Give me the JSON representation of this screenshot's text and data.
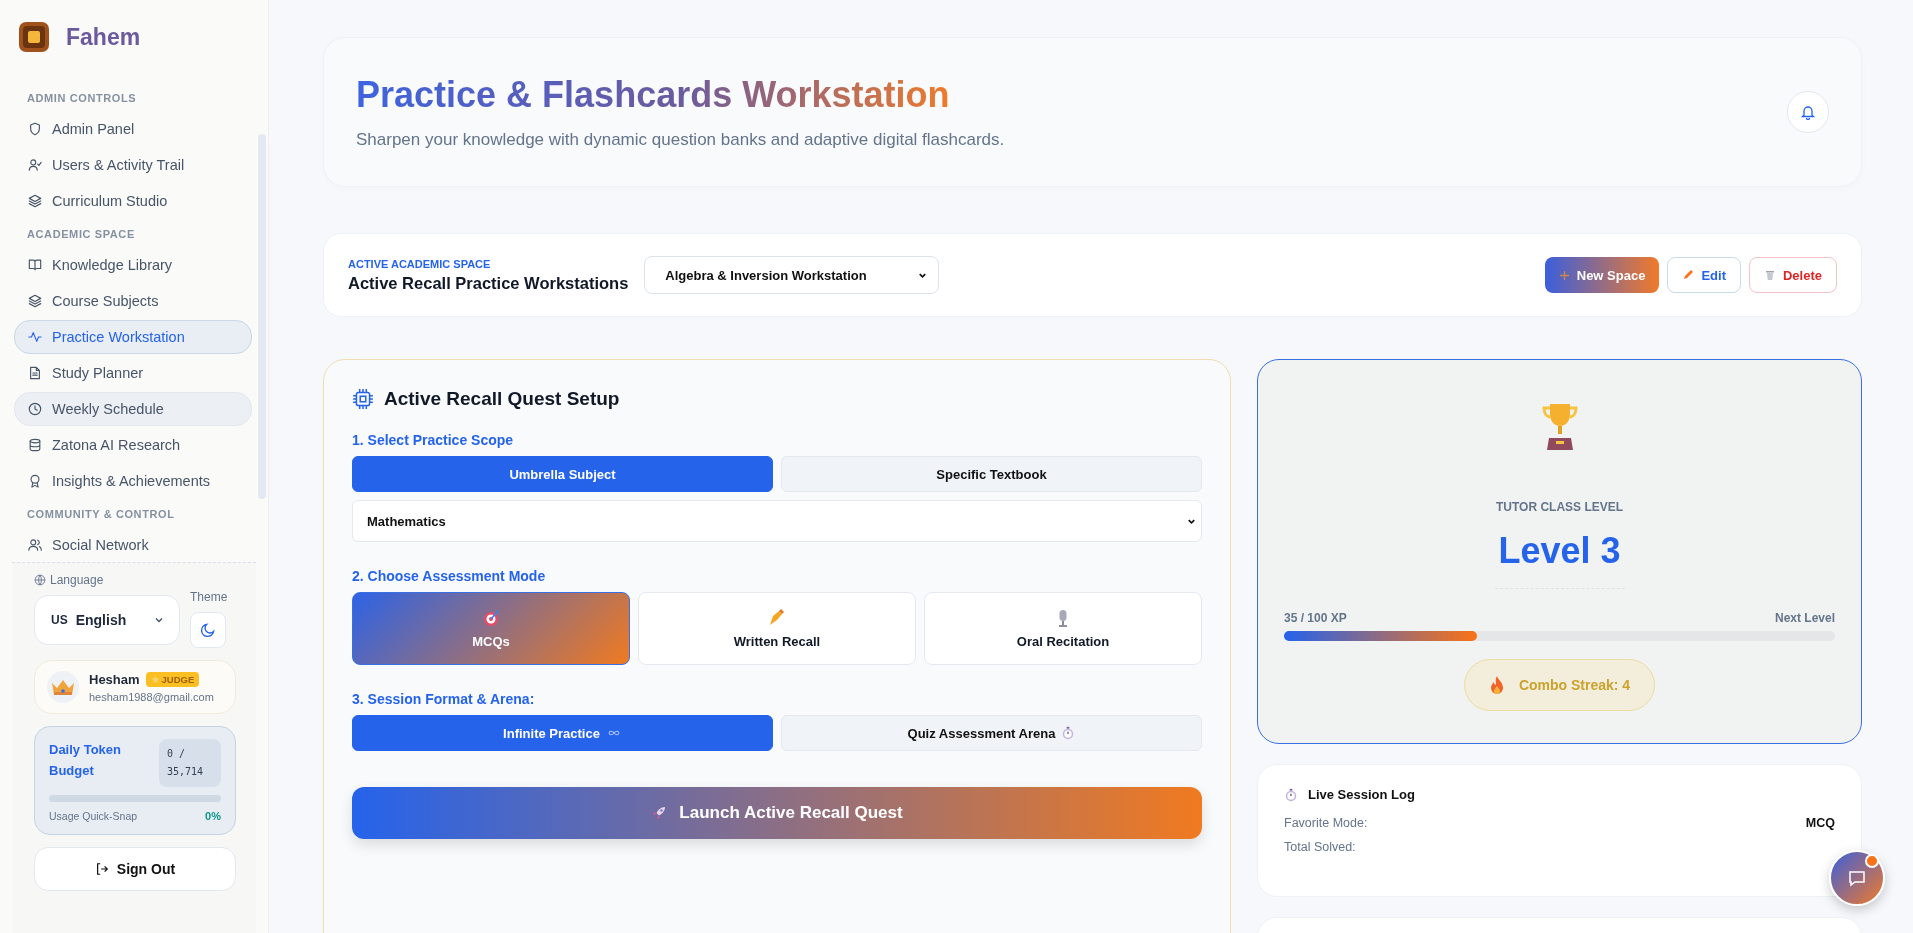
{
  "brand": {
    "name": "Fahem"
  },
  "sidebar": {
    "sections": [
      {
        "heading": "ADMIN CONTROLS",
        "items": [
          {
            "label": "Admin Panel",
            "selected": false,
            "hovered": false
          },
          {
            "label": "Users & Activity Trail",
            "selected": false,
            "hovered": false
          },
          {
            "label": "Curriculum Studio",
            "selected": false,
            "hovered": false
          }
        ]
      },
      {
        "heading": "ACADEMIC SPACE",
        "items": [
          {
            "label": "Knowledge Library",
            "selected": false,
            "hovered": false
          },
          {
            "label": "Course Subjects",
            "selected": false,
            "hovered": false
          },
          {
            "label": "Practice Workstation",
            "selected": true,
            "hovered": false
          },
          {
            "label": "Study Planner",
            "selected": false,
            "hovered": false
          },
          {
            "label": "Weekly Schedule",
            "selected": false,
            "hovered": true
          },
          {
            "label": "Zatona AI Research",
            "selected": false,
            "hovered": false
          },
          {
            "label": "Insights & Achievements",
            "selected": false,
            "hovered": false
          }
        ]
      },
      {
        "heading": "COMMUNITY & CONTROL",
        "items": [
          {
            "label": "Social Network",
            "selected": false,
            "hovered": false
          }
        ]
      }
    ]
  },
  "language": {
    "label": "Language",
    "flag": "US",
    "value": "English"
  },
  "theme": {
    "label": "Theme"
  },
  "user": {
    "name": "Hesham",
    "badge": "JUDGE",
    "email": "hesham1988@gmail.com"
  },
  "budget": {
    "title": "Daily Token Budget",
    "count": "0 / 35,714",
    "level": 0,
    "caption": "Usage Quick-Snap",
    "percent": "0%"
  },
  "sign_out": "Sign Out",
  "header": {
    "title": "Practice & Flashcards Workstation",
    "subtitle": "Sharpen your knowledge with dynamic question banks and adaptive digital flashcards."
  },
  "space": {
    "eyebrow": "ACTIVE ACADEMIC SPACE",
    "title": "Active Recall Practice Workstations",
    "selected_space": "Algebra & Inversion Workstation",
    "buttons": [
      {
        "kind": "new",
        "label": "New Space"
      },
      {
        "kind": "edit",
        "label": "Edit"
      },
      {
        "kind": "delete",
        "label": "Delete"
      }
    ]
  },
  "quest": {
    "title": "Active Recall Quest Setup",
    "scope_label": "1. Select Practice Scope",
    "scopes": [
      {
        "label": "Umbrella Subject",
        "selected": true
      },
      {
        "label": "Specific Textbook",
        "selected": false
      }
    ],
    "subject": "Mathematics",
    "mode_label": "2. Choose Assessment Mode",
    "modes": [
      {
        "kind": "target",
        "label": "MCQs",
        "selected": true
      },
      {
        "kind": "writing",
        "label": "Written Recall",
        "selected": false
      },
      {
        "kind": "microphone",
        "label": "Oral Recitation",
        "selected": false
      }
    ],
    "format_label": "3. Session Format & Arena:",
    "formats": [
      {
        "kind": "infinity",
        "label": "Infinite Practice",
        "selected": true
      },
      {
        "kind": "stopwatch",
        "label": "Quiz Assessment Arena",
        "selected": false
      }
    ],
    "launch": "Launch Active Recall Quest"
  },
  "level_card": {
    "caption": "TUTOR CLASS LEVEL",
    "level_name": "Level 3",
    "xp": "35 / 100 XP",
    "next": "Next Level",
    "level": 0.35,
    "streak": "Combo Streak: 4"
  },
  "log": {
    "title": "Live Session Log",
    "rows": [
      {
        "label": "Favorite Mode:",
        "value": "MCQ"
      },
      {
        "label": "Total Solved:"
      }
    ]
  }
}
